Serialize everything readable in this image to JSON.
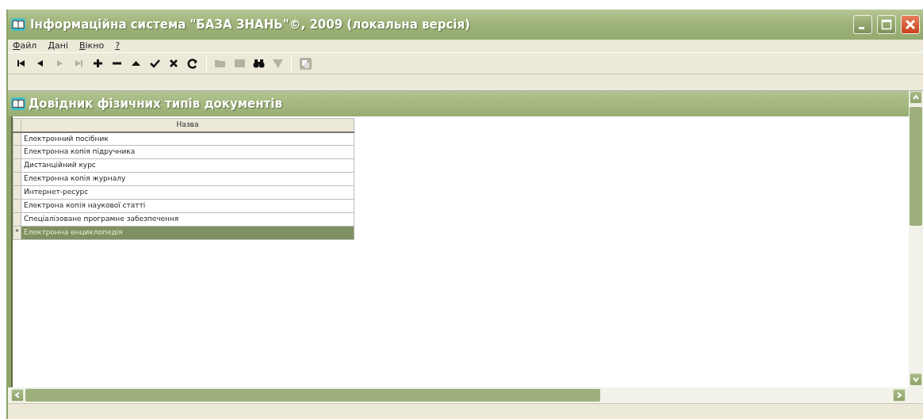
{
  "window": {
    "title": "Інформаційна система \"БАЗА ЗНАНЬ\"©, 2009 (локальна версія)"
  },
  "menu": [
    {
      "label": "Файл",
      "underline_first": true
    },
    {
      "label": "Дані",
      "underline_first": true
    },
    {
      "label": "Вікно",
      "underline_first": true
    },
    {
      "label": "?",
      "underline_first": true
    }
  ],
  "toolbar": [
    {
      "kind": "first",
      "disabled": false
    },
    {
      "kind": "prior",
      "disabled": false
    },
    {
      "kind": "next",
      "disabled": true
    },
    {
      "kind": "last",
      "disabled": true
    },
    {
      "kind": "insert",
      "disabled": false
    },
    {
      "kind": "delete",
      "disabled": false
    },
    {
      "kind": "edit",
      "disabled": false
    },
    {
      "kind": "post",
      "disabled": false
    },
    {
      "kind": "cancel",
      "disabled": false
    },
    {
      "kind": "refresh",
      "disabled": false
    },
    {
      "kind": "separator"
    },
    {
      "kind": "open",
      "disabled": true
    },
    {
      "kind": "panel",
      "disabled": true
    },
    {
      "kind": "find",
      "disabled": false
    },
    {
      "kind": "filter",
      "disabled": true
    },
    {
      "kind": "separator"
    },
    {
      "kind": "copy",
      "disabled": true
    }
  ],
  "child_window": {
    "title": "Довідник фізичних типів документів"
  },
  "table": {
    "columns": [
      "Назва"
    ],
    "rows": [
      {
        "name": "Електронний посібник",
        "selected": false
      },
      {
        "name": "Електронна копія підручника",
        "selected": false
      },
      {
        "name": "Дистанційний курс",
        "selected": false
      },
      {
        "name": "Електронна копія журналу",
        "selected": false
      },
      {
        "name": "Интернет-ресурс",
        "selected": false
      },
      {
        "name": "Електрона копія наукової статті",
        "selected": false
      },
      {
        "name": "Спеціалізоване програмне забезпечення",
        "selected": false
      },
      {
        "name": "Електронна енциклопедія",
        "selected": true,
        "indicator": "*"
      }
    ]
  }
}
